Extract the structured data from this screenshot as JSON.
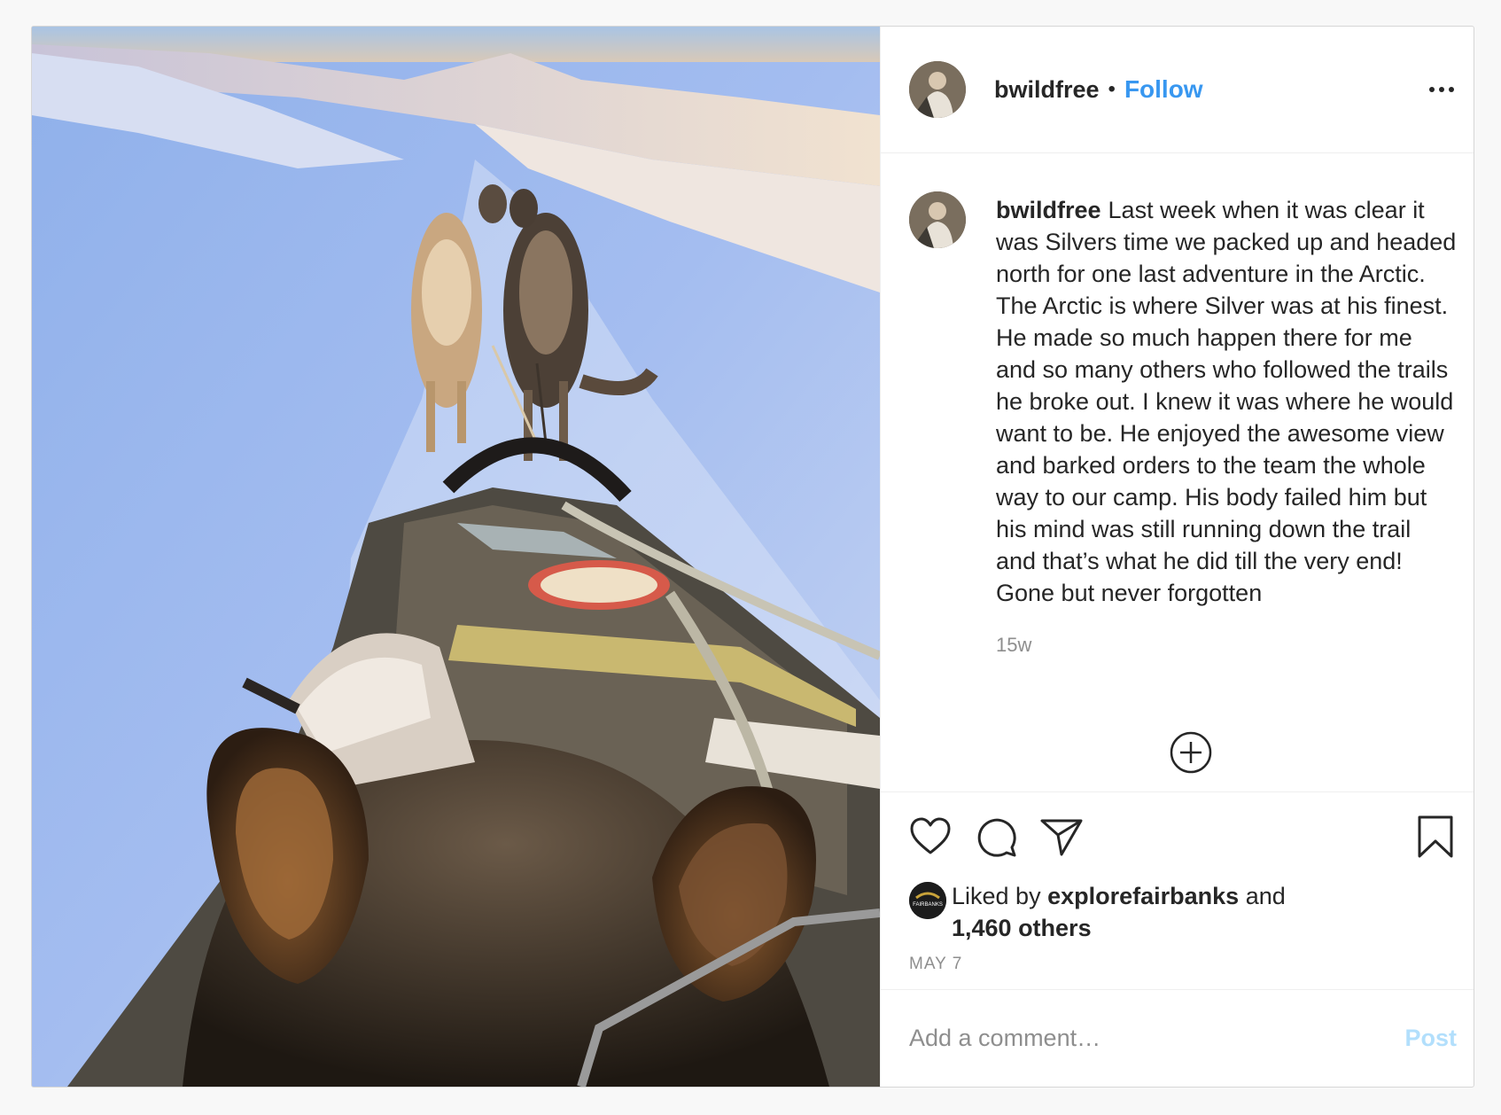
{
  "post": {
    "author": {
      "username": "bwildfree",
      "avatar_icon": "user-avatar-photo"
    },
    "header": {
      "separator": "•",
      "follow_label": "Follow",
      "more_icon": "more-options-icon"
    },
    "caption": {
      "username": "bwildfree",
      "text": "Last week when it was clear it was Silvers time we packed up and headed north for one last adventure in the Arctic. The Arctic is where Silver was at his finest. He made so much happen there for me and so many others who followed the trails he broke out. I knew it was where he would want to be. He enjoyed the awesome view and barked orders to the team the whole way to our camp. His body failed him but his mind was still running down the trail and that’s what he did till the very end! Gone but never forgotten",
      "relative_time": "15w"
    },
    "actions": {
      "like_icon": "heart-icon",
      "comment_icon": "comment-icon",
      "share_icon": "share-icon",
      "save_icon": "bookmark-icon",
      "load_more_icon": "plus-circle-icon"
    },
    "likes": {
      "prefix": "Liked by",
      "liker": "explorefairbanks",
      "conjunction": "and",
      "others": "1,460 others",
      "liker_avatar_text": "FAIRBANKS"
    },
    "date": "MAY 7",
    "comment_box": {
      "placeholder": "Add a comment…",
      "post_label": "Post"
    },
    "colors": {
      "link_blue": "#3897f0",
      "post_disabled": "#b2dffc",
      "muted_text": "#8e8e8e",
      "border": "#efefef"
    }
  }
}
